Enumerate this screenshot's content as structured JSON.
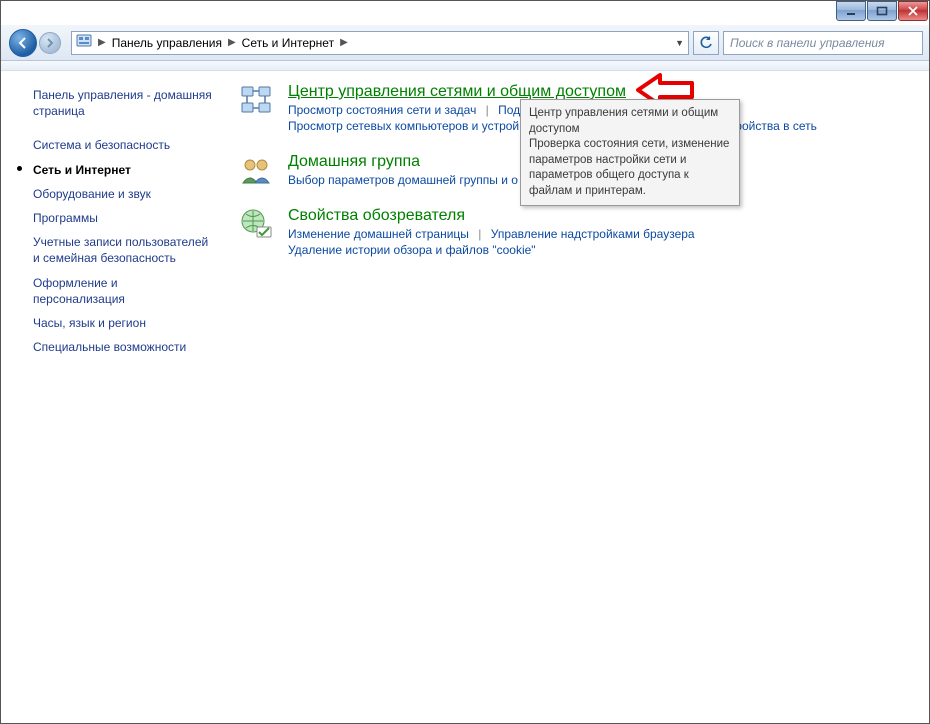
{
  "breadcrumbs": [
    "Панель управления",
    "Сеть и Интернет"
  ],
  "search_placeholder": "Поиск в панели управления",
  "sidebar": {
    "home": "Панель управления - домашняя страница",
    "items": [
      "Система и безопасность",
      "Сеть и Интернет",
      "Оборудование и звук",
      "Программы",
      "Учетные записи пользователей и семейная безопасность",
      "Оформление и персонализация",
      "Часы, язык и регион",
      "Специальные возможности"
    ],
    "current_index": 1
  },
  "categories": [
    {
      "title": "Центр управления сетями и общим доступом",
      "tasks_row1": [
        "Просмотр состояния сети и задач",
        "Подключение к сети"
      ],
      "tasks_row2": [
        "Просмотр сетевых компьютеров и устройств",
        "Добавление беспроводного устройства в сеть"
      ],
      "truncated1": "Под",
      "truncated2_left": "Просмотр сетевых компьютеров и устрой",
      "truncated2_right": "тройства в сеть"
    },
    {
      "title": "Домашняя группа",
      "tasks_row1": [
        "Выбор параметров домашней группы и общего доступа к данным"
      ],
      "truncated1": "Выбор параметров домашней группы и о"
    },
    {
      "title": "Свойства обозревателя",
      "tasks_row1": [
        "Изменение домашней страницы",
        "Управление надстройками браузера"
      ],
      "tasks_row2": [
        "Удаление истории обзора и файлов \"cookie\""
      ]
    }
  ],
  "tooltip": {
    "title": "Центр управления сетями и общим доступом",
    "body": "Проверка состояния сети, изменение параметров настройки сети и параметров общего доступа к файлам и принтерам."
  }
}
